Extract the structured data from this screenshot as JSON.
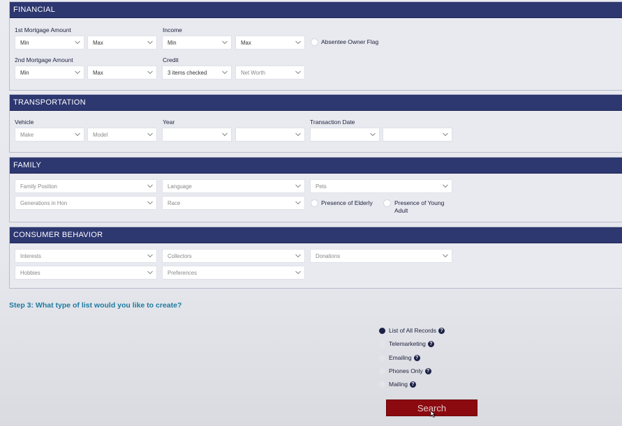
{
  "financial": {
    "title": "FINANCIAL",
    "first_mortgage_label": "1st Mortgage Amount",
    "first_mortgage_min": "Min",
    "first_mortgage_max": "Max",
    "income_label": "Income",
    "income_min": "Min",
    "income_max": "Max",
    "absentee_owner_label": "Absentee Owner Flag",
    "second_mortgage_label": "2nd Mortgage Amount",
    "second_mortgage_min": "Min",
    "second_mortgage_max": "Max",
    "credit_label": "Credit",
    "credit_value": "3 items checked",
    "net_worth_placeholder": "Net Worth"
  },
  "transportation": {
    "title": "TRANSPORTATION",
    "vehicle_label": "Vehicle",
    "make_placeholder": "Make",
    "model_placeholder": "Model",
    "year_label": "Year",
    "transaction_date_label": "Transaction Date"
  },
  "family": {
    "title": "FAMILY",
    "family_position": "Family Position",
    "language": "Language",
    "pets": "Pets",
    "generations": "Generations in Hon",
    "race": "Race",
    "presence_elderly": "Presence of Elderly",
    "presence_young_adult_line1": "Presence of Young",
    "presence_young_adult_line2": "Adult"
  },
  "consumer_behavior": {
    "title": "CONSUMER BEHAVIOR",
    "interests": "Interests",
    "collectors": "Collectors",
    "donations": "Donations",
    "hobbies": "Hobbies",
    "preferences": "Preferences"
  },
  "step3": {
    "question": "Step 3: What type of list would you like to create?",
    "options": [
      {
        "label": "List of All Records",
        "selected": true
      },
      {
        "label": "Telemarketing",
        "selected": false
      },
      {
        "label": "Emailing",
        "selected": false
      },
      {
        "label": "Phones Only",
        "selected": false
      },
      {
        "label": "Mailing",
        "selected": false
      }
    ],
    "help_glyph": "?",
    "search_label": "Search"
  },
  "icons": {
    "dropdown": "chevron-down-icon",
    "help": "question-circle-icon",
    "cursor": "mouse-pointer-icon"
  },
  "colors": {
    "header": "#2d3770",
    "accent_text": "#1e7aa0",
    "search_button": "#8b0a10",
    "selected_radio": "#1c2147"
  }
}
